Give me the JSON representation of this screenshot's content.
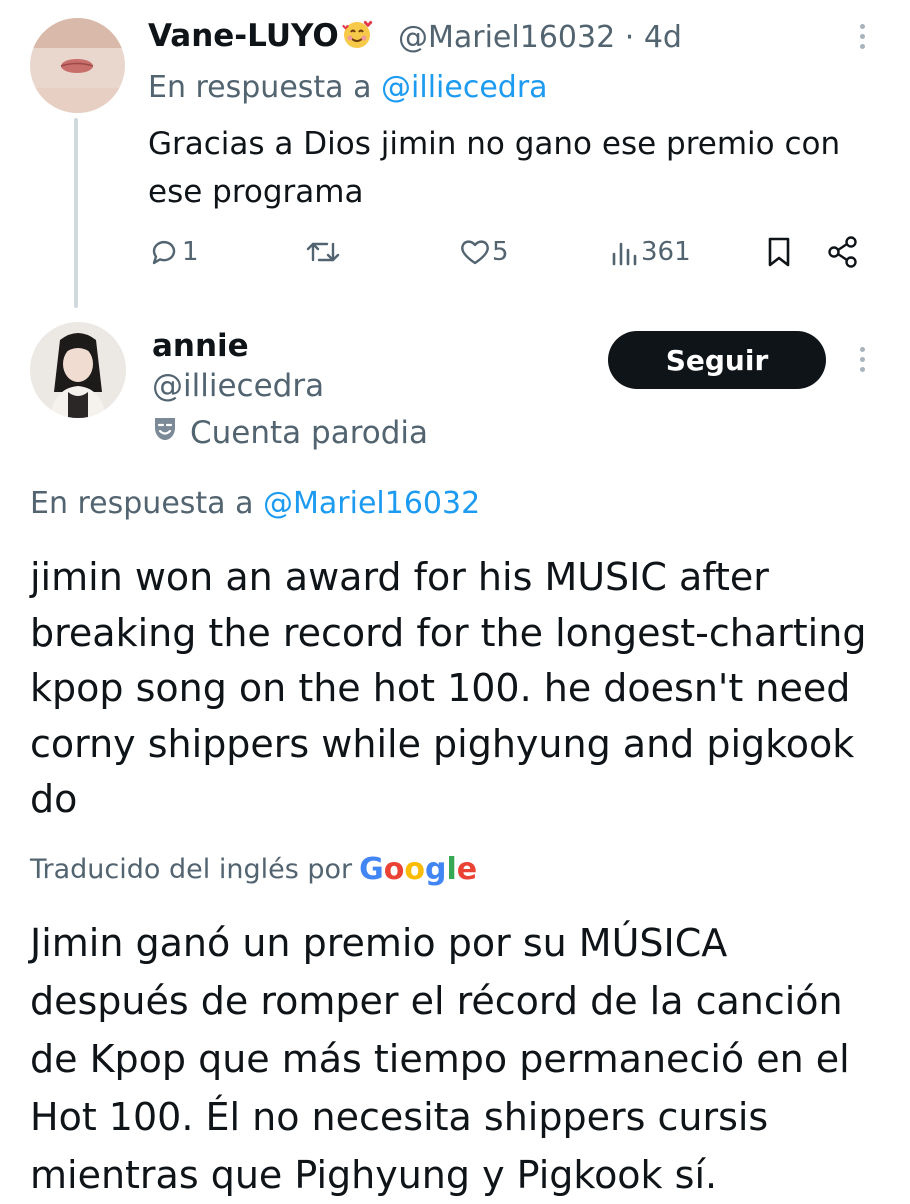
{
  "reply": {
    "display_name": "Vane-LUYO",
    "name_emoji": "smiling-face-with-hearts-emoji",
    "handle": "@Mariel16032",
    "separator": "·",
    "time": "4d",
    "in_reply_prefix": "En respuesta a",
    "in_reply_handle": "@illiecedra",
    "text": "Gracias a Dios jimin no gano ese premio con ese programa",
    "actions": {
      "replies": "1",
      "retweets": "",
      "likes": "5",
      "views": "361"
    },
    "icons": [
      "comment-icon",
      "retweet-icon",
      "heart-icon",
      "views-icon",
      "bookmark-icon",
      "share-icon",
      "more-icon"
    ]
  },
  "tweet": {
    "display_name": "annie",
    "handle": "@illiecedra",
    "parody_label": "Cuenta parodia",
    "follow_label": "Seguir",
    "in_reply_prefix": "En respuesta a",
    "in_reply_handle": "@Mariel16032",
    "body": "jimin won an award for his MUSIC after breaking the record for the longest-charting kpop song on the hot 100. he doesn't need corny shippers while pighyung and pigkook do",
    "translated_by": "Traducido del inglés por",
    "translator_brand": "Google",
    "translation": "Jimin ganó un premio por su MÚSICA después de romper el récord de la canción de Kpop que más tiempo permaneció en el Hot 100. Él no necesita shippers cursis mientras que Pighyung y Pigkook sí."
  },
  "colors": {
    "link": "#1d9bf0",
    "muted": "#536471",
    "follow_button_bg": "#0f1419",
    "google_blue": "#4285F4",
    "google_red": "#EA4335",
    "google_yellow": "#FBBC05",
    "google_green": "#34A853"
  }
}
